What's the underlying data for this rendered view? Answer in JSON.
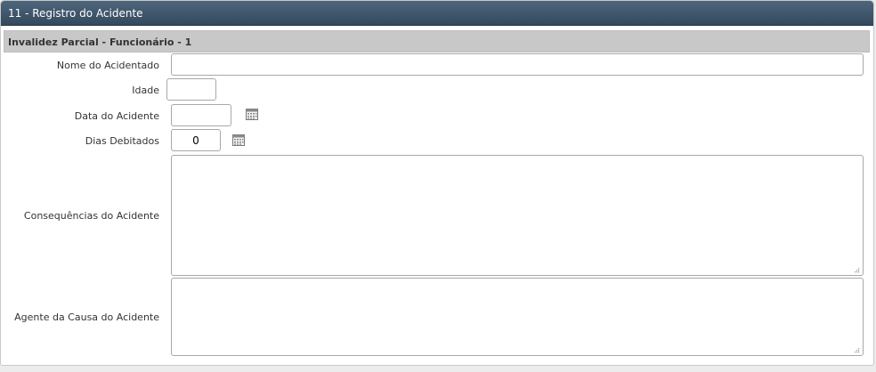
{
  "section": {
    "title": "11 - Registro do Acidente"
  },
  "subsection": {
    "title": "Invalidez Parcial - Funcionário - 1"
  },
  "form": {
    "nome": {
      "label": "Nome do Acidentado",
      "value": ""
    },
    "idade": {
      "label": "Idade",
      "value": ""
    },
    "data": {
      "label": "Data do Acidente",
      "value": "",
      "icon": "calendar-icon"
    },
    "dias": {
      "label": "Dias Debitados",
      "value": "0",
      "icon": "calendar-icon"
    },
    "consequencias": {
      "label": "Consequências do Acidente",
      "value": ""
    },
    "agente": {
      "label": "Agente da Causa do Acidente",
      "value": ""
    }
  },
  "colors": {
    "header": "#3f556b",
    "subheader": "#c8c8c8",
    "border": "#a8a8a8"
  }
}
